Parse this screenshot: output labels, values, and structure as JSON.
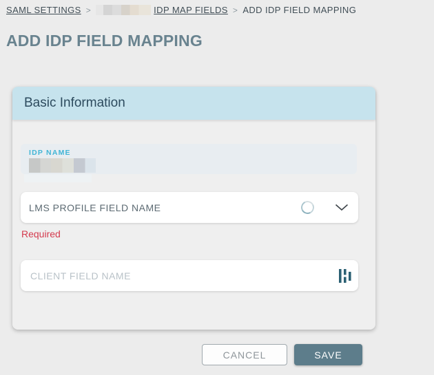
{
  "breadcrumb": {
    "saml_settings": "SAML SETTINGS",
    "idp_map_fields": "IDP MAP FIELDS",
    "add_idp_field_mapping": "ADD IDP FIELD MAPPING",
    "separator": ">"
  },
  "page_title": "ADD IDP FIELD MAPPING",
  "card": {
    "header": "Basic Information",
    "idp_name": {
      "label": "IDP NAME",
      "value_redacted": true
    },
    "lms_profile_field": {
      "label": "LMS PROFILE FIELD NAME",
      "error": "Required",
      "icons": [
        "spinner-icon",
        "chevron-down-icon"
      ]
    },
    "client_field": {
      "placeholder": "CLIENT FIELD NAME",
      "icon": "bars-icon"
    }
  },
  "actions": {
    "cancel_label": "CANCEL",
    "save_label": "SAVE"
  },
  "colors": {
    "page_background": "#ececec",
    "card_header_background": "#c6e3ed",
    "card_body_background": "#efefef",
    "accent_teal": "#41b5d6",
    "error_red": "#d43b4e",
    "save_button_background": "#5d7d8b",
    "title_color": "#69838f",
    "icon_teal": "#2b6073"
  }
}
